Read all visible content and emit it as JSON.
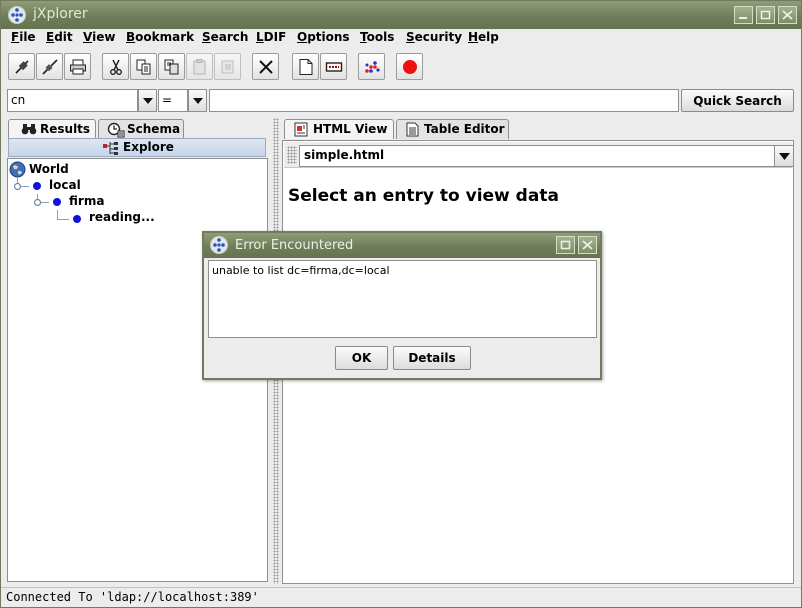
{
  "window": {
    "title": "jXplorer"
  },
  "menu": [
    "File",
    "Edit",
    "View",
    "Bookmark",
    "Search",
    "LDIF",
    "Options",
    "Tools",
    "Security",
    "Help"
  ],
  "search": {
    "attribute": "cn",
    "operator": "=",
    "value": "",
    "button_label": "Quick Search"
  },
  "left_tabs": [
    "Results",
    "Schema"
  ],
  "left_subtab": "Explore",
  "tree": {
    "root": "World",
    "level1": "local",
    "level2": "firma",
    "level3": "reading..."
  },
  "right_tabs": [
    "HTML View",
    "Table Editor"
  ],
  "html_view": {
    "page": "simple.html",
    "message": "Select an entry to view data"
  },
  "status": {
    "text": "Connected To 'ldap://localhost:389'"
  },
  "dialog": {
    "title": "Error Encountered",
    "message": "unable to list dc=firma,dc=local",
    "ok_label": "OK",
    "details_label": "Details"
  },
  "colors": {
    "titlebar": "#6f7d5a",
    "tree_dot": "#1010e0",
    "subtab": "#c6d6ea"
  }
}
